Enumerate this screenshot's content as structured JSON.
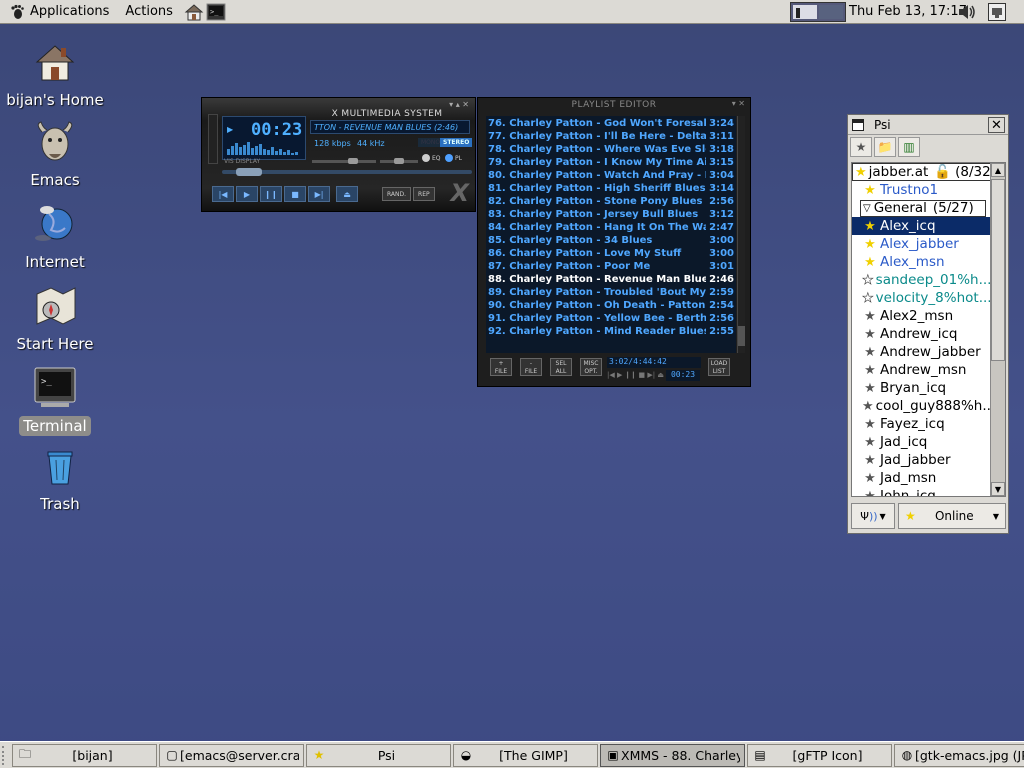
{
  "top_panel": {
    "menu_applications": "Applications",
    "menu_actions": "Actions",
    "clock": "Thu Feb 13, 17:17"
  },
  "desktop": {
    "icons": [
      {
        "label": "bijan's Home",
        "icon": "home-icon"
      },
      {
        "label": "Emacs",
        "icon": "gnu-icon"
      },
      {
        "label": "Internet",
        "icon": "globe-icon"
      },
      {
        "label": "Start Here",
        "icon": "compass-map-icon"
      },
      {
        "label": "Terminal",
        "icon": "terminal-icon"
      },
      {
        "label": "Trash",
        "icon": "trash-icon"
      }
    ]
  },
  "xmms": {
    "title": "X MULTIMEDIA SYSTEM",
    "time": "00:23",
    "ticker": "TTON - REVENUE MAN BLUES (2:46)",
    "bitrate": "128 kbps",
    "khz": "44 kHz",
    "mono": "MONO",
    "stereo": "STEREO",
    "eq_label": "EQ",
    "pl_label": "PL",
    "vis_label": "VIS DISPLAY",
    "rand_label": "RAND.",
    "rep_label": "REP",
    "logo": "X",
    "clutter": "OAIDV"
  },
  "playlist": {
    "title": "PLAYLIST EDITOR",
    "rows": [
      {
        "text": "76. Charley Patton - God Won't Foresake ...",
        "time": "3:24"
      },
      {
        "text": "77. Charley Patton - I'll Be Here - Delta Bi...",
        "time": "3:11"
      },
      {
        "text": "78. Charley Patton - Where Was Eve Slee...",
        "time": "3:18"
      },
      {
        "text": "79. Charley Patton - I Know My Time Ain'...",
        "time": "3:15"
      },
      {
        "text": "80. Charley Patton - Watch And Pray - De...",
        "time": "3:04"
      },
      {
        "text": "81. Charley Patton - High Sheriff Blues",
        "time": "3:14"
      },
      {
        "text": "82. Charley Patton - Stone Pony Blues",
        "time": "2:56"
      },
      {
        "text": "83. Charley Patton - Jersey Bull Blues",
        "time": "3:12"
      },
      {
        "text": "84. Charley Patton - Hang It On The Wall",
        "time": "2:47"
      },
      {
        "text": "85. Charley Patton - 34 Blues",
        "time": "3:00"
      },
      {
        "text": "86. Charley Patton - Love My Stuff",
        "time": "3:00"
      },
      {
        "text": "87. Charley Patton - Poor Me",
        "time": "3:01"
      },
      {
        "text": "88. Charley Patton - Revenue Man Blues",
        "time": "2:46",
        "current": true
      },
      {
        "text": "89. Charley Patton - Troubled 'Bout My M...",
        "time": "2:59"
      },
      {
        "text": "90. Charley Patton - Oh Death - Patton A...",
        "time": "2:54"
      },
      {
        "text": "91. Charley Patton - Yellow Bee - Bertha...",
        "time": "2:56"
      },
      {
        "text": "92. Charley Patton - Mind Reader Blues - ...",
        "time": "2:55"
      }
    ],
    "buttons": [
      {
        "top": "+",
        "bottom": "FILE"
      },
      {
        "top": "-",
        "bottom": "FILE"
      },
      {
        "top": "SEL",
        "bottom": "ALL"
      },
      {
        "top": "MISC",
        "bottom": "OPT."
      }
    ],
    "load": {
      "top": "LOAD",
      "bottom": "LIST"
    },
    "info": "3:02/4:44:42",
    "mini_time": "00:23"
  },
  "psi": {
    "title": "Psi",
    "account": "jabber.at",
    "account_count": "(8/32",
    "contacts_top": [
      "Trustno1"
    ],
    "group": "General",
    "group_count": "(5/27)",
    "contacts": [
      {
        "name": "Alex_icq",
        "state": "online",
        "selected": true
      },
      {
        "name": "Alex_jabber",
        "state": "online"
      },
      {
        "name": "Alex_msn",
        "state": "online"
      },
      {
        "name": "sandeep_01%h...",
        "state": "away"
      },
      {
        "name": "velocity_8%hot...",
        "state": "away"
      },
      {
        "name": "Alex2_msn",
        "state": "offline"
      },
      {
        "name": "Andrew_icq",
        "state": "offline"
      },
      {
        "name": "Andrew_jabber",
        "state": "offline"
      },
      {
        "name": "Andrew_msn",
        "state": "offline"
      },
      {
        "name": "Bryan_icq",
        "state": "offline"
      },
      {
        "name": "cool_guy888%h...",
        "state": "offline"
      },
      {
        "name": "Fayez_icq",
        "state": "offline"
      },
      {
        "name": "Jad_icq",
        "state": "offline"
      },
      {
        "name": "Jad_jabber",
        "state": "offline"
      },
      {
        "name": "Jad_msn",
        "state": "offline"
      },
      {
        "name": "John_icq",
        "state": "offline"
      }
    ],
    "status": "Online"
  },
  "taskbar": {
    "tasks": [
      {
        "label": "[bijan]",
        "icon": "folder-icon"
      },
      {
        "label": "[emacs@server.cras",
        "icon": "window-icon"
      },
      {
        "label": "Psi",
        "icon": "star-icon"
      },
      {
        "label": "[The GIMP]",
        "icon": "gimp-icon"
      },
      {
        "label": "XMMS - 88. Charley",
        "icon": "xmms-icon",
        "active": true
      },
      {
        "label": "[gFTP Icon]",
        "icon": "document-icon"
      },
      {
        "label": "[gtk-emacs.jpg (JPEG",
        "icon": "image-icon"
      }
    ]
  },
  "colors": {
    "desktop_bg": "#414d85",
    "panel_bg": "#dcdad5",
    "xmms_text": "#4fa7ff",
    "psi_selection": "#0b2b68"
  }
}
